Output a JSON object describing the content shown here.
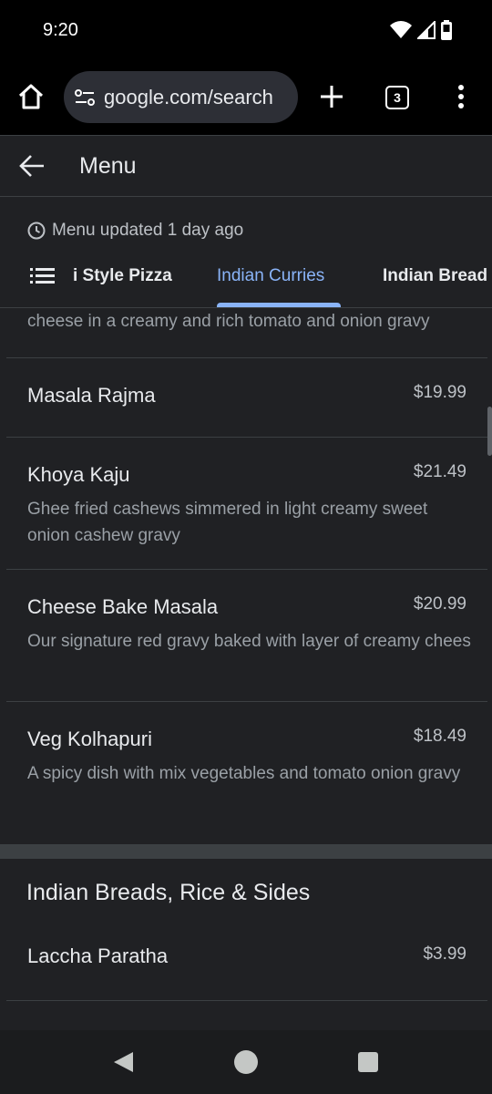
{
  "status_bar": {
    "time": "9:20"
  },
  "toolbar": {
    "url": "google.com/search",
    "tab_count": "3"
  },
  "header": {
    "title": "Menu"
  },
  "updated": "Menu updated 1 day ago",
  "categories": {
    "items": [
      {
        "label": "i Style Pizza"
      },
      {
        "label": "Indian Curries"
      },
      {
        "label": "Indian Bread"
      }
    ],
    "active": "Indian Curries"
  },
  "partial_desc": "cheese in a creamy and rich tomato and onion gravy",
  "items": [
    {
      "name": "Masala Rajma",
      "price": "$19.99",
      "desc": ""
    },
    {
      "name": "Khoya Kaju",
      "price": "$21.49",
      "desc": "Ghee fried cashews simmered in light creamy sweet onion cashew gravy"
    },
    {
      "name": "Cheese Bake Masala",
      "price": "$20.99",
      "desc": "Our signature red gravy baked with layer of creamy chees"
    },
    {
      "name": "Veg Kolhapuri",
      "price": "$18.49",
      "desc": "A spicy dish with mix vegetables and tomato onion gravy"
    }
  ],
  "section2": {
    "title": "Indian Breads, Rice & Sides",
    "items": [
      {
        "name": "Laccha Paratha",
        "price": "$3.99"
      }
    ]
  },
  "colors": {
    "accent": "#8ab4f8",
    "background": "#202124",
    "divider": "#3c4043"
  }
}
